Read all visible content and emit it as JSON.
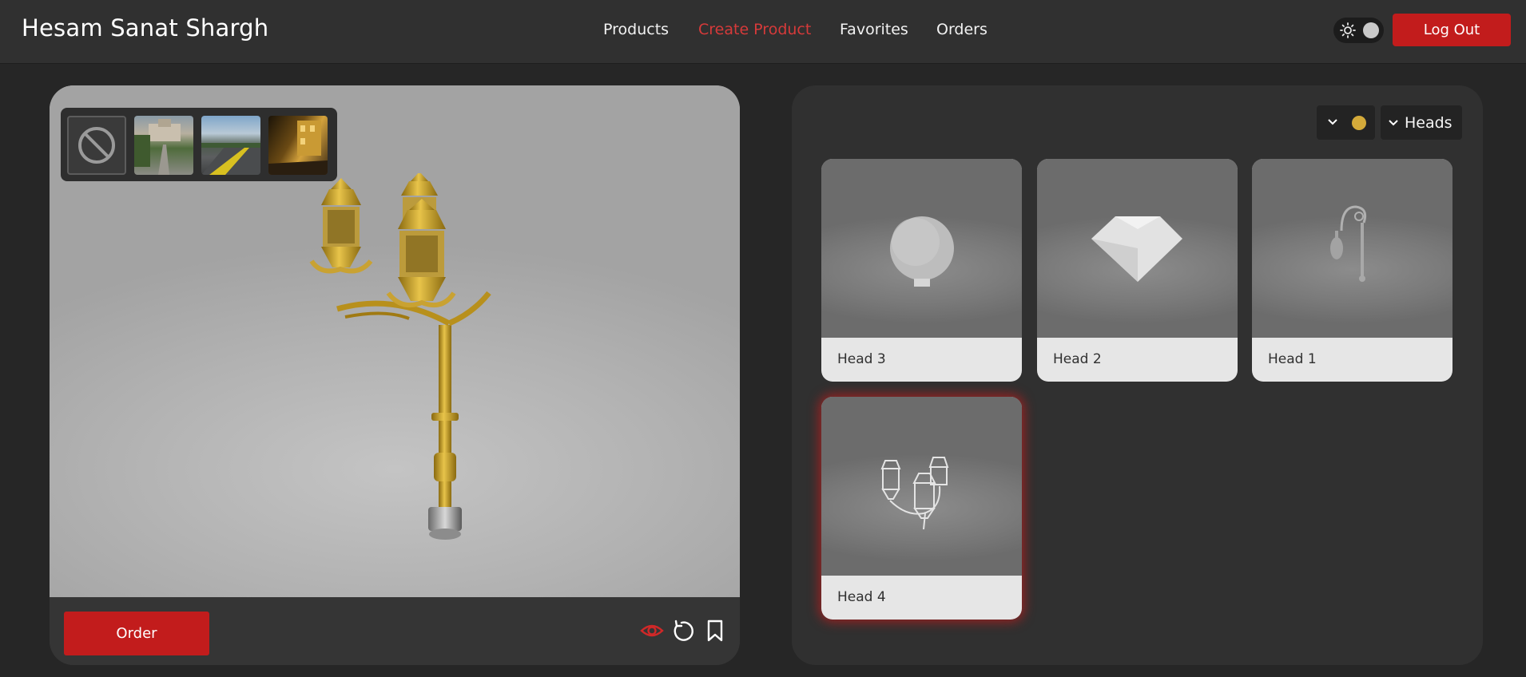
{
  "header": {
    "brand": "Hesam Sanat Shargh",
    "nav": [
      {
        "label": "Products",
        "active": false
      },
      {
        "label": "Create Product",
        "active": true
      },
      {
        "label": "Favorites",
        "active": false
      },
      {
        "label": "Orders",
        "active": false
      }
    ],
    "theme_toggle_icon": "sun-icon",
    "logout_label": "Log Out"
  },
  "viewer": {
    "environments": [
      {
        "name": "none",
        "icon": "no-symbol-icon"
      },
      {
        "name": "park"
      },
      {
        "name": "road"
      },
      {
        "name": "night-street"
      }
    ],
    "order_label": "Order",
    "toolbar_icons": [
      "eye-icon",
      "reset-icon",
      "bookmark-icon"
    ]
  },
  "panel": {
    "selected_color": "#d4aa3a",
    "category": "Heads",
    "cards": [
      {
        "name": "Head 3",
        "shape": "globe",
        "selected": false
      },
      {
        "name": "Head 2",
        "shape": "diamond",
        "selected": false
      },
      {
        "name": "Head 1",
        "shape": "hanging",
        "selected": false
      },
      {
        "name": "Head 4",
        "shape": "lantern",
        "selected": true
      }
    ]
  },
  "colors": {
    "accent_red": "#c21c1c",
    "active_nav": "#d63a3a",
    "gold": "#d4aa3a"
  }
}
